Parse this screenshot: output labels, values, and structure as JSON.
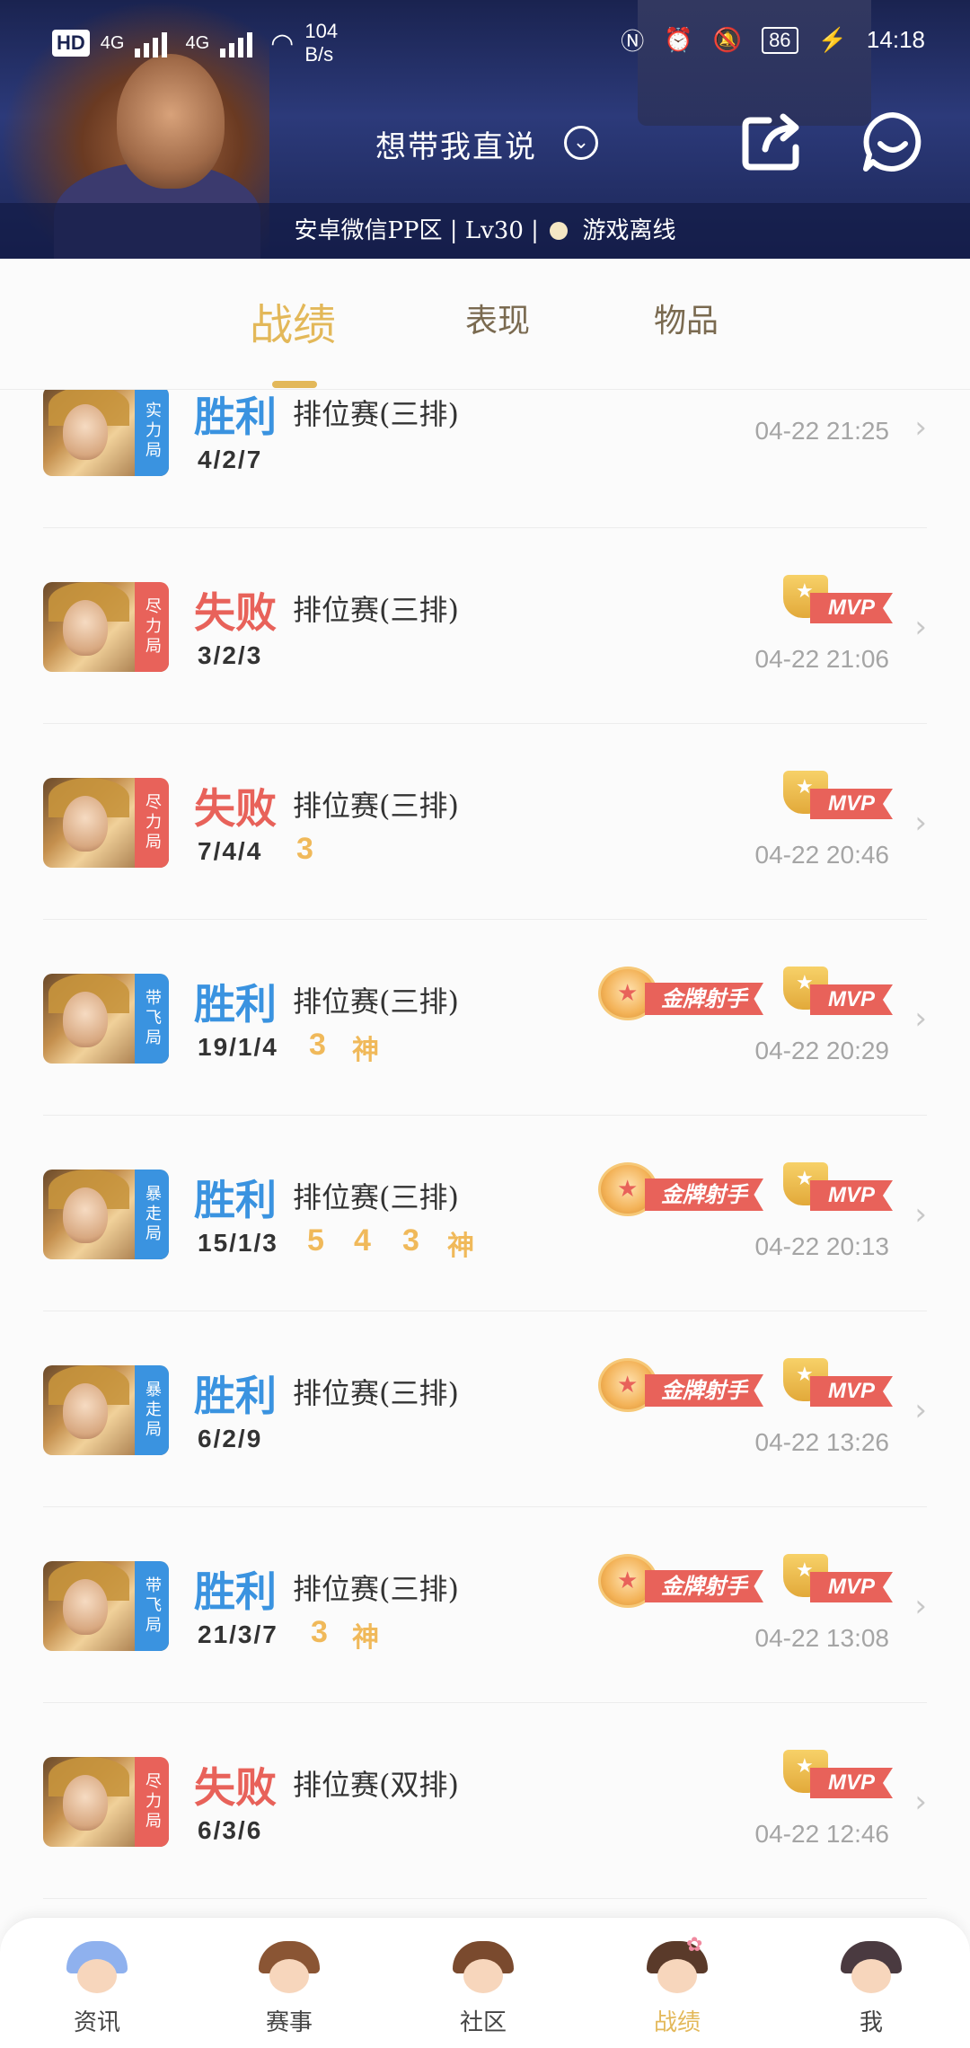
{
  "status_bar": {
    "hd": "HD",
    "sim1": "4G",
    "sim2": "4G",
    "speed_value": "104",
    "speed_unit": "B/s",
    "battery": "86",
    "time": "14:18"
  },
  "header": {
    "player_name": "想带我直说",
    "server": "安卓微信PP区",
    "level": "Lv30",
    "status": "游戏离线"
  },
  "tabs": [
    {
      "label": "战绩",
      "active": true
    },
    {
      "label": "表现",
      "active": false
    },
    {
      "label": "物品",
      "active": false
    }
  ],
  "matches": [
    {
      "result": "胜利",
      "outcome": "win",
      "mode": "排位赛(三排)",
      "kda": "4/2/7",
      "tag": "实力局",
      "tag_color": "blue",
      "time": "04-22 21:25",
      "mvp": false,
      "gold": false,
      "achievements": []
    },
    {
      "result": "失败",
      "outcome": "lose",
      "mode": "排位赛(三排)",
      "kda": "3/2/3",
      "tag": "尽力局",
      "tag_color": "red",
      "time": "04-22 21:06",
      "mvp": true,
      "gold": false,
      "achievements": []
    },
    {
      "result": "失败",
      "outcome": "lose",
      "mode": "排位赛(三排)",
      "kda": "7/4/4",
      "tag": "尽力局",
      "tag_color": "red",
      "time": "04-22 20:46",
      "mvp": true,
      "gold": false,
      "achievements": [
        "3"
      ]
    },
    {
      "result": "胜利",
      "outcome": "win",
      "mode": "排位赛(三排)",
      "kda": "19/1/4",
      "tag": "带飞局",
      "tag_color": "blue",
      "time": "04-22 20:29",
      "mvp": true,
      "gold": true,
      "achievements": [
        "3",
        "神"
      ]
    },
    {
      "result": "胜利",
      "outcome": "win",
      "mode": "排位赛(三排)",
      "kda": "15/1/3",
      "tag": "暴走局",
      "tag_color": "blue",
      "time": "04-22 20:13",
      "mvp": true,
      "gold": true,
      "achievements": [
        "5",
        "4",
        "3",
        "神"
      ]
    },
    {
      "result": "胜利",
      "outcome": "win",
      "mode": "排位赛(三排)",
      "kda": "6/2/9",
      "tag": "暴走局",
      "tag_color": "blue",
      "time": "04-22 13:26",
      "mvp": true,
      "gold": true,
      "achievements": []
    },
    {
      "result": "胜利",
      "outcome": "win",
      "mode": "排位赛(三排)",
      "kda": "21/3/7",
      "tag": "带飞局",
      "tag_color": "blue",
      "time": "04-22 13:08",
      "mvp": true,
      "gold": true,
      "achievements": [
        "3",
        "神"
      ]
    },
    {
      "result": "失败",
      "outcome": "lose",
      "mode": "排位赛(双排)",
      "kda": "6/3/6",
      "tag": "尽力局",
      "tag_color": "red",
      "time": "04-22 12:46",
      "mvp": true,
      "gold": false,
      "achievements": []
    }
  ],
  "badges": {
    "mvp": "MVP",
    "gold": "金牌射手"
  },
  "bottom_nav": [
    {
      "label": "资讯",
      "icon": "blue-hair-avatar-icon",
      "active": false
    },
    {
      "label": "赛事",
      "icon": "brown-hair-avatar-icon",
      "active": false
    },
    {
      "label": "社区",
      "icon": "boy-avatar-icon",
      "active": false
    },
    {
      "label": "战绩",
      "icon": "flower-girl-avatar-icon",
      "active": true
    },
    {
      "label": "我",
      "icon": "dark-hair-avatar-icon",
      "active": false
    }
  ],
  "colors": {
    "win": "#3a93e0",
    "lose": "#e8625a",
    "accent": "#e3b859",
    "achievement": "#f0b95a"
  }
}
